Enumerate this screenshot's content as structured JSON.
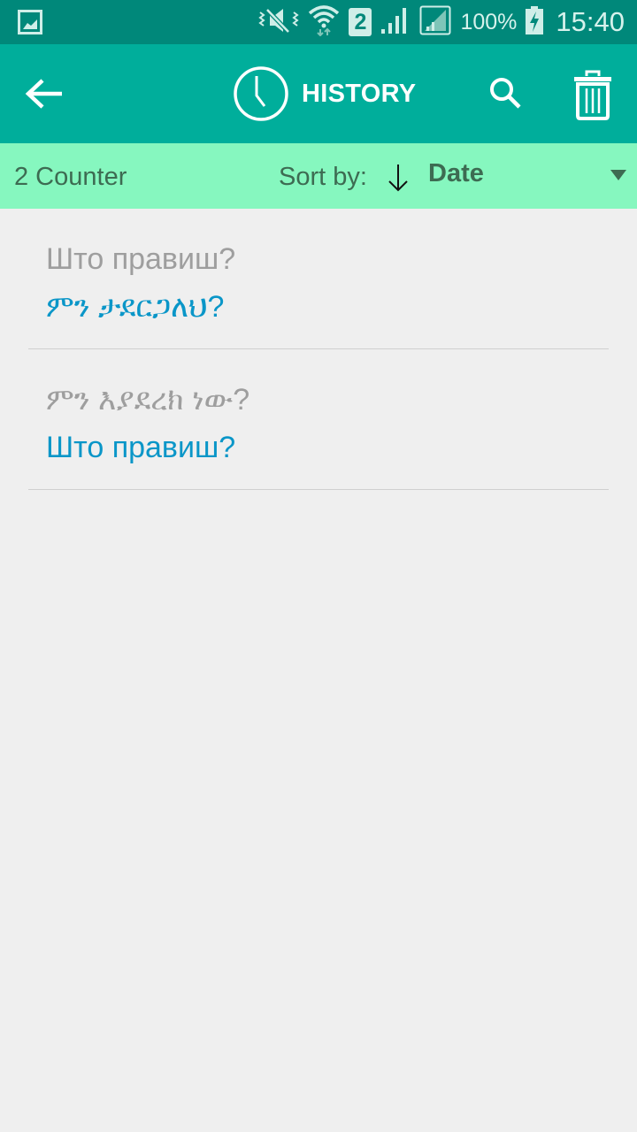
{
  "status_bar": {
    "left_icon": "gallery-notification-icon",
    "icons": [
      "vibrate-mute-icon",
      "wifi-icon",
      "sim-2-icon",
      "signal-icon",
      "signal-roaming-icon",
      "battery-charging-icon"
    ],
    "sim_label": "2",
    "battery": "100%",
    "time": "15:40"
  },
  "toolbar": {
    "title": "HISTORY",
    "back_icon": "arrow-left-icon",
    "title_icon": "clock-icon",
    "search_icon": "search-icon",
    "delete_icon": "trash-icon"
  },
  "sort_bar": {
    "counter": "2 Counter",
    "sort_label": "Sort by:",
    "direction_icon": "arrow-down-icon",
    "sort_value": "Date",
    "dropdown_icon": "triangle-down-icon"
  },
  "history": [
    {
      "source": "Што правиш?",
      "translation": "ምን ታደርጋለህ?"
    },
    {
      "source": "ምን እያደረክ ነው?",
      "translation": "Што правиш?"
    }
  ],
  "colors": {
    "status_bar": "#00887a",
    "toolbar": "#00ae9b",
    "sort_bar": "#86f7bf",
    "source_text": "#9e9e9e",
    "translation_text": "#0a96c8"
  }
}
